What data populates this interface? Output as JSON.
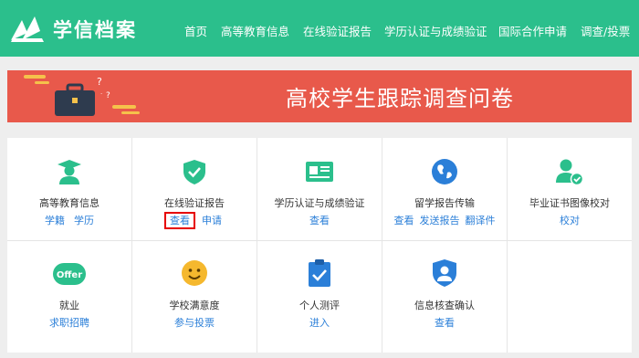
{
  "header": {
    "logo_text": "学信档案",
    "nav": [
      "首页",
      "高等教育信息",
      "在线验证报告",
      "学历认证与成绩验证",
      "国际合作申请",
      "调查/投票"
    ]
  },
  "banner": {
    "title": "高校学生跟踪调查问卷"
  },
  "services": [
    {
      "title": "高等教育信息",
      "links": [
        "学籍",
        "学历"
      ],
      "icon": "graduate-icon"
    },
    {
      "title": "在线验证报告",
      "links": [
        "查看",
        "申请"
      ],
      "icon": "shield-check-icon",
      "highlighted_link": "查看"
    },
    {
      "title": "学历认证与成绩验证",
      "links": [
        "查看"
      ],
      "icon": "id-card-icon"
    },
    {
      "title": "留学报告传输",
      "links": [
        "查看",
        "发送报告",
        "翻译件"
      ],
      "icon": "globe-icon"
    },
    {
      "title": "毕业证书图像校对",
      "links": [
        "校对"
      ],
      "icon": "user-check-icon"
    },
    {
      "title": "就业",
      "links": [
        "求职招聘"
      ],
      "icon": "offer-icon",
      "icon_text": "Offer"
    },
    {
      "title": "学校满意度",
      "links": [
        "参与投票"
      ],
      "icon": "smiley-icon"
    },
    {
      "title": "个人测评",
      "links": [
        "进入"
      ],
      "icon": "clipboard-check-icon"
    },
    {
      "title": "信息核查确认",
      "links": [
        "查看"
      ],
      "icon": "user-badge-icon"
    }
  ],
  "colors": {
    "header": "#2bbf8c",
    "banner": "#e8594b",
    "link": "#2b7fd8",
    "icon_green": "#2bbf8c",
    "icon_blue": "#2b7fd8",
    "highlight": "#e60000"
  }
}
